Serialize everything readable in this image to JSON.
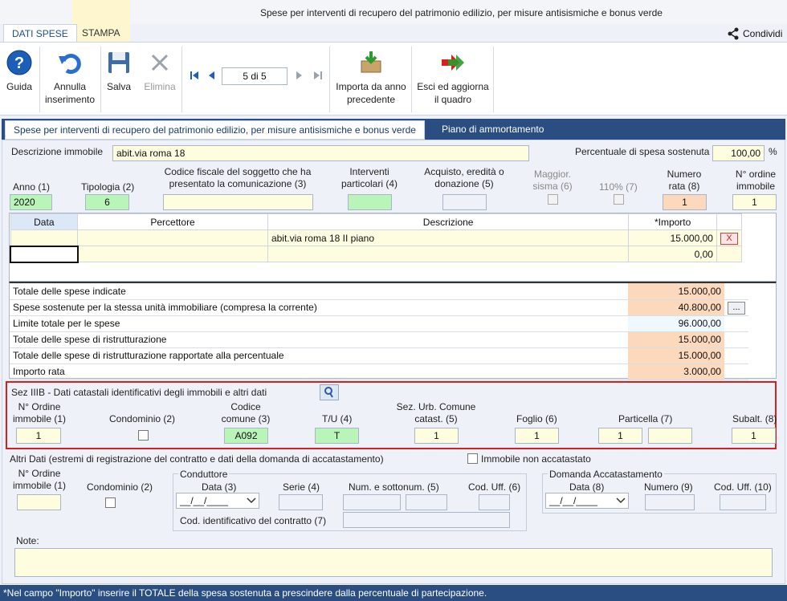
{
  "window_title": "Spese per interventi di recupero del patrimonio edilizio, per misure antisismiche e bonus verde",
  "tabs": [
    "DATI SPESE",
    "STAMPA"
  ],
  "share_label": "Condividi",
  "toolbar": {
    "guida": "Guida",
    "annulla": "Annulla inserimento",
    "salva": "Salva",
    "elimina": "Elimina",
    "nav_value": "5 di 5",
    "importa": "Importa da anno precedente",
    "esci": "Esci ed aggiorna il quadro"
  },
  "section_tabs": [
    "Spese per interventi di recupero del patrimonio edilizio, per misure antisismiche e bonus verde",
    "Piano di ammortamento"
  ],
  "descrizione_immobile_label": "Descrizione immobile",
  "descrizione_immobile_value": "abit.via roma 18",
  "percentuale_label": "Percentuale di spesa sostenuta",
  "percentuale_value": "100,00",
  "percentuale_unit": "%",
  "fields_row": {
    "anno_label": "Anno (1)",
    "anno_value": "2020",
    "tipologia_label": "Tipologia (2)",
    "tipologia_value": "6",
    "cf_label": "Codice fiscale del soggetto che ha presentato la comunicazione (3)",
    "interventi_label": "Interventi particolari (4)",
    "acquisto_label": "Acquisto, eredità o donazione (5)",
    "maggior_label": "Maggior. sisma (6)",
    "p110_label": "110% (7)",
    "numero_rata_label": "Numero rata (8)",
    "numero_rata_value": "1",
    "ordine_label": "N° ordine immobile",
    "ordine_value": "1"
  },
  "spese_table": {
    "headers": [
      "Data",
      "Percettore",
      "Descrizione",
      "*Importo"
    ],
    "rows": [
      {
        "data": "",
        "percettore": "",
        "descrizione": "abit.via roma 18 II piano",
        "importo": "15.000,00",
        "action": "X"
      },
      {
        "data": "",
        "percettore": "",
        "descrizione": "",
        "importo": "0,00",
        "action": ""
      }
    ]
  },
  "totali": [
    {
      "label": "Totale delle spese indicate",
      "value": "15.000,00"
    },
    {
      "label": "Spese sostenute per la stessa unità immobiliare (compresa la corrente)",
      "value": "40.800,00",
      "button": "..."
    },
    {
      "label": "Limite totale per le spese",
      "value": "96.000,00"
    },
    {
      "label": "Totale delle spese di ristrutturazione",
      "value": "15.000,00"
    },
    {
      "label": "Totale delle spese di ristrutturazione rapportate alla percentuale",
      "value": "15.000,00"
    },
    {
      "label": "Importo rata",
      "value": "3.000,00"
    }
  ],
  "sez3b": {
    "title": "Sez IIIB - Dati catastali identificativi degli immobili e altri dati",
    "ordine_label": "N° Ordine immobile (1)",
    "ordine_value": "1",
    "condominio_label": "Condominio (2)",
    "codice_comune_label": "Codice comune (3)",
    "codice_comune_value": "A092",
    "tu_label": "T/U (4)",
    "tu_value": "T",
    "sez_urb_label": "Sez. Urb. Comune catast. (5)",
    "sez_urb_value": "1",
    "foglio_label": "Foglio (6)",
    "foglio_value": "1",
    "particella_label": "Particella (7)",
    "particella_value": "1",
    "subalt_label": "Subalt. (8)",
    "subalt_value": "1"
  },
  "altri": {
    "title": "Altri Dati (estremi di registrazione del contratto e dati della domanda di accatastamento)",
    "non_accatastato_label": "Immobile non accatastato",
    "ordine_label": "N° Ordine immobile (1)",
    "condominio_label": "Condominio (2)",
    "conduttore_title": "Conduttore",
    "data_label": "Data (3)",
    "data_value": "__/__/____",
    "serie_label": "Serie (4)",
    "num_label": "Num. e sottonum. (5)",
    "cod_uff_label": "Cod. Uff. (6)",
    "cod_contratto_label": "Cod. identificativo del contratto (7)",
    "domanda_title": "Domanda Accatastamento",
    "data8_label": "Data (8)",
    "data8_value": "__/__/____",
    "numero_label": "Numero (9)",
    "cod_uff10_label": "Cod. Uff. (10)"
  },
  "note_label": "Note:",
  "footer": "*Nel campo \"Importo\" inserire il TOTALE della spesa sostenuta a prescindere dalla percentuale di partecipazione."
}
